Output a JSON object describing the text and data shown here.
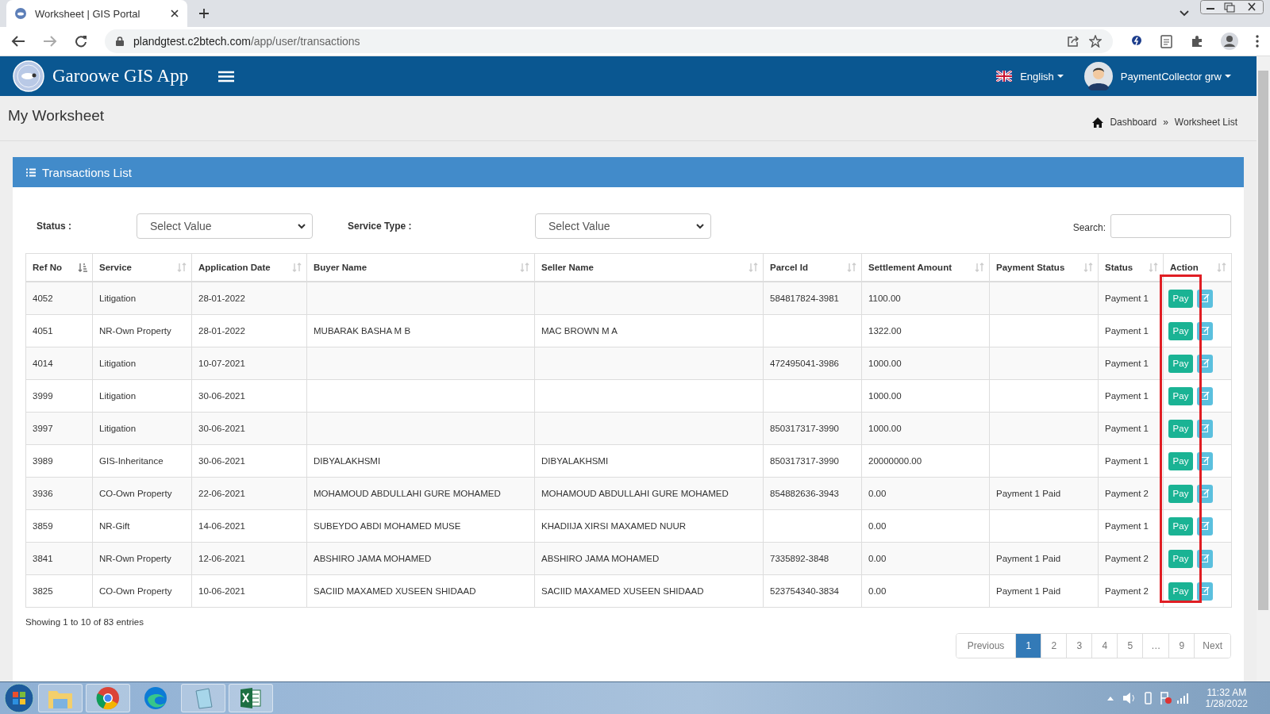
{
  "browser": {
    "tab_title": "Worksheet | GIS Portal",
    "url_host": "plandgtest.c2btech.com",
    "url_path": "/app/user/transactions"
  },
  "header": {
    "app_name": "Garoowe GIS App",
    "language": "English",
    "user": "PaymentCollector grw"
  },
  "page": {
    "title": "My Worksheet",
    "breadcrumbs": [
      {
        "label": "Dashboard"
      },
      {
        "label": "Worksheet List"
      }
    ],
    "separator": "»"
  },
  "card": {
    "title": "Transactions List"
  },
  "filters": [
    {
      "label": "Status :",
      "placeholder": "Select Value"
    },
    {
      "label": "Service Type :",
      "placeholder": "Select Value"
    }
  ],
  "search": {
    "label": "Search:"
  },
  "table": {
    "columns": [
      {
        "label": "Ref No",
        "sorted": true
      },
      {
        "label": "Service",
        "sorted": false
      },
      {
        "label": "Application Date",
        "sorted": false
      },
      {
        "label": "Buyer Name",
        "sorted": false
      },
      {
        "label": "Seller Name",
        "sorted": false
      },
      {
        "label": "Parcel Id",
        "sorted": false
      },
      {
        "label": "Settlement Amount",
        "sorted": false
      },
      {
        "label": "Payment Status",
        "sorted": false
      },
      {
        "label": "Status",
        "sorted": false
      },
      {
        "label": "Action",
        "sorted": false
      }
    ],
    "rows": [
      {
        "cells": [
          "4052",
          "Litigation",
          "28-01-2022",
          "",
          "",
          "584817824-3981",
          "1100.00",
          "",
          "Payment 1"
        ],
        "action": "Pay"
      },
      {
        "cells": [
          "4051",
          "NR-Own Property",
          "28-01-2022",
          "MUBARAK BASHA M B",
          "MAC BROWN M A",
          "",
          "1322.00",
          "",
          "Payment 1"
        ],
        "action": "Pay"
      },
      {
        "cells": [
          "4014",
          "Litigation",
          "10-07-2021",
          "",
          "",
          "472495041-3986",
          "1000.00",
          "",
          "Payment 1"
        ],
        "action": "Pay"
      },
      {
        "cells": [
          "3999",
          "Litigation",
          "30-06-2021",
          "",
          "",
          "",
          "1000.00",
          "",
          "Payment 1"
        ],
        "action": "Pay"
      },
      {
        "cells": [
          "3997",
          "Litigation",
          "30-06-2021",
          "",
          "",
          "850317317-3990",
          "1000.00",
          "",
          "Payment 1"
        ],
        "action": "Pay"
      },
      {
        "cells": [
          "3989",
          "GIS-Inheritance",
          "30-06-2021",
          "DIBYALAKHSMI",
          "DIBYALAKHSMI",
          "850317317-3990",
          "20000000.00",
          "",
          "Payment 1"
        ],
        "action": "Pay"
      },
      {
        "cells": [
          "3936",
          "CO-Own Property",
          "22-06-2021",
          "MOHAMOUD ABDULLAHI GURE MOHAMED",
          "MOHAMOUD ABDULLAHI GURE MOHAMED",
          "854882636-3943",
          "0.00",
          "Payment 1 Paid",
          "Payment 2"
        ],
        "action": "Pay"
      },
      {
        "cells": [
          "3859",
          "NR-Gift",
          "14-06-2021",
          "SUBEYDO ABDI MOHAMED MUSE",
          "KHADIIJA XIRSI MAXAMED NUUR",
          "",
          "0.00",
          "",
          "Payment 1"
        ],
        "action": "Pay"
      },
      {
        "cells": [
          "3841",
          "NR-Own Property",
          "12-06-2021",
          "ABSHIRO JAMA MOHAMED",
          "ABSHIRO JAMA MOHAMED",
          "7335892-3848",
          "0.00",
          "Payment 1 Paid",
          "Payment 2"
        ],
        "action": "Pay"
      },
      {
        "cells": [
          "3825",
          "CO-Own Property",
          "10-06-2021",
          "SACIID MAXAMED XUSEEN SHIDAAD",
          "SACIID MAXAMED XUSEEN SHIDAAD",
          "523754340-3834",
          "0.00",
          "Payment 1 Paid",
          "Payment 2"
        ],
        "action": "Pay"
      }
    ]
  },
  "info": "Showing 1 to 10 of 83 entries",
  "pagination": [
    {
      "label": "Previous",
      "selected": false
    },
    {
      "label": "1",
      "selected": true
    },
    {
      "label": "2",
      "selected": false
    },
    {
      "label": "3",
      "selected": false
    },
    {
      "label": "4",
      "selected": false
    },
    {
      "label": "5",
      "selected": false
    },
    {
      "label": "…",
      "selected": false
    },
    {
      "label": "9",
      "selected": false
    },
    {
      "label": "Next",
      "selected": false
    }
  ],
  "taskbar": {
    "time": "11:32 AM",
    "date": "1/28/2022"
  }
}
